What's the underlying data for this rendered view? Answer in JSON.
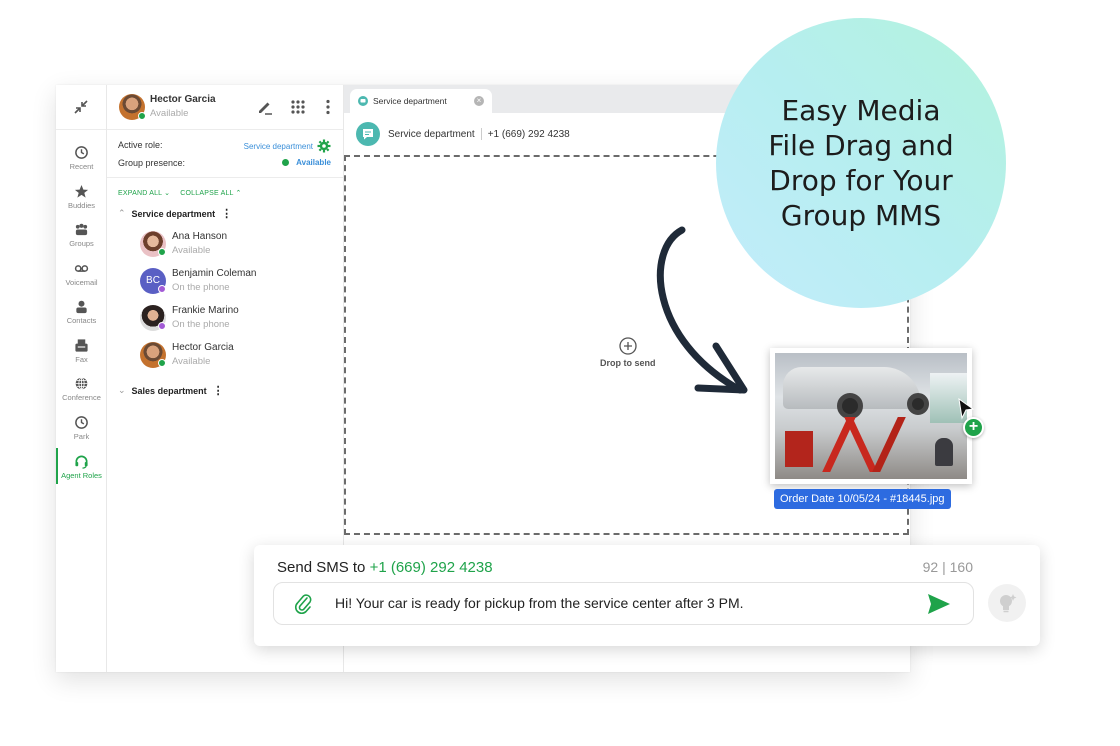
{
  "rail": {
    "items": [
      {
        "label": "Recent",
        "icon": "history-icon"
      },
      {
        "label": "Buddies",
        "icon": "star-icon"
      },
      {
        "label": "Groups",
        "icon": "groups-icon"
      },
      {
        "label": "Voicemail",
        "icon": "voicemail-icon"
      },
      {
        "label": "Contacts",
        "icon": "contact-icon"
      },
      {
        "label": "Fax",
        "icon": "fax-icon"
      },
      {
        "label": "Conference",
        "icon": "globe-icon"
      },
      {
        "label": "Park",
        "icon": "clock-icon"
      },
      {
        "label": "Agent Roles",
        "icon": "headset-icon",
        "active": true
      }
    ]
  },
  "user": {
    "name": "Hector Garcia",
    "status": "Available"
  },
  "roles": {
    "active_role_label": "Active role:",
    "active_role_value": "Service department",
    "presence_label": "Group presence:",
    "presence_value": "Available"
  },
  "controls": {
    "expand_all": "EXPAND ALL",
    "collapse_all": "COLLAPSE ALL"
  },
  "groups": [
    {
      "name": "Service department",
      "expanded": true,
      "members": [
        {
          "name": "Ana Hanson",
          "status": "Available",
          "initials": ""
        },
        {
          "name": "Benjamin Coleman",
          "status": "On the phone",
          "initials": "BC"
        },
        {
          "name": "Frankie Marino",
          "status": "On the phone",
          "initials": ""
        },
        {
          "name": "Hector Garcia",
          "status": "Available",
          "initials": ""
        }
      ]
    },
    {
      "name": "Sales department",
      "expanded": false,
      "members": []
    }
  ],
  "tab": {
    "label": "Service department"
  },
  "conversation": {
    "name": "Service department",
    "phone": "+1 (669) 292 4238"
  },
  "dropzone": {
    "label": "Drop to send"
  },
  "promo": {
    "line1": "Easy Media",
    "line2": "File Drag and",
    "line3": "Drop for Your",
    "line4": "Group MMS"
  },
  "file": {
    "name": "Order Date 10/05/24 - #18445.jpg"
  },
  "sms": {
    "prefix": "Send SMS to",
    "phone": "+1 (669) 292 4238",
    "count": "92 | 160",
    "message": "Hi! Your car is ready for pickup from the service center after 3 PM."
  },
  "colors": {
    "accent": "#1fa34a",
    "link": "#3a8fd9",
    "file_label": "#2d6be0",
    "phone_status": "#a35bd6"
  }
}
